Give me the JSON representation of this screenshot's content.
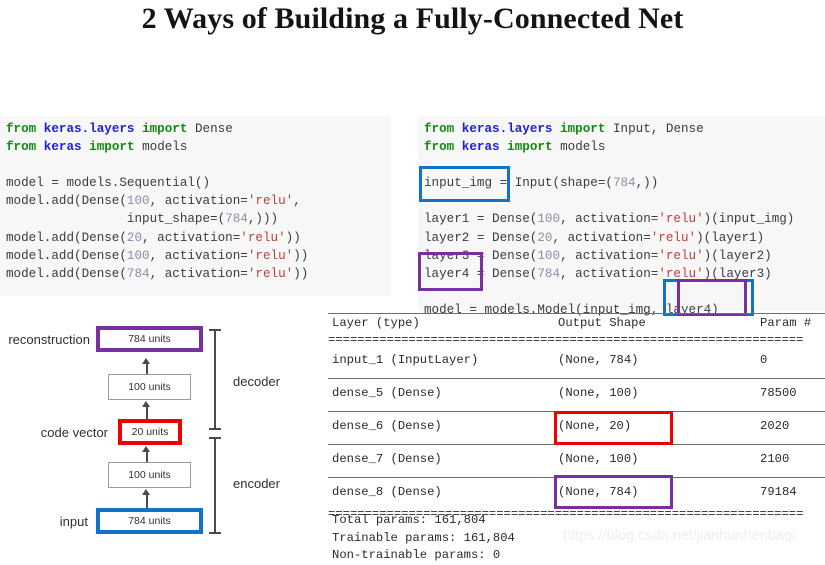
{
  "title": "2 Ways of Building a Fully-Connected Net",
  "colors": {
    "blue": "#1273c4",
    "purple": "#7a2f9e",
    "red": "#ee0000",
    "keyword_green": "#138a13",
    "module_blue": "#2020dd",
    "string_red": "#c43b3b",
    "number_gray": "#8d8da6",
    "code_background": "#f7f7f7"
  },
  "code_left": {
    "name": "sequential-api-code",
    "lines": [
      "from keras.layers import Dense",
      "from keras import models",
      "",
      "model = models.Sequential()",
      "model.add(Dense(100, activation='relu',",
      "                input_shape=(784,)))",
      "model.add(Dense(20, activation='relu'))",
      "model.add(Dense(100, activation='relu'))",
      "model.add(Dense(784, activation='relu'))"
    ]
  },
  "code_right": {
    "name": "functional-api-code",
    "lines": [
      "from keras.layers import Input, Dense",
      "from keras import models",
      "",
      "input_img = Input(shape=(784,))",
      "",
      "layer1 = Dense(100, activation='relu')(input_img)",
      "layer2 = Dense(20, activation='relu')(layer1)",
      "layer3 = Dense(100, activation='relu')(layer2)",
      "layer4 = Dense(784, activation='relu')(layer3)",
      "",
      "model = models.Model(input_img, layer4)"
    ],
    "highlights": [
      {
        "name": "input-img-definition",
        "color": "blue",
        "text": "input_img"
      },
      {
        "name": "layer4-definition",
        "color": "purple",
        "text": "layer4"
      },
      {
        "name": "model-input-arg",
        "color": "blue",
        "text": "input_img,"
      },
      {
        "name": "model-output-arg",
        "color": "purple",
        "text": "layer4)"
      }
    ]
  },
  "diagram": {
    "name": "autoencoder-architecture",
    "nodes": [
      {
        "label": "784 units",
        "side_label": "reconstruction",
        "border": "purple"
      },
      {
        "label": "100 units",
        "side_label": "",
        "border": "plain"
      },
      {
        "label": "20 units",
        "side_label": "code vector",
        "border": "red"
      },
      {
        "label": "100 units",
        "side_label": "",
        "border": "plain"
      },
      {
        "label": "784 units",
        "side_label": "input",
        "border": "blue"
      }
    ],
    "brackets": [
      {
        "label": "decoder"
      },
      {
        "label": "encoder"
      }
    ]
  },
  "summary": {
    "name": "model-summary-table",
    "headers": {
      "layer": "Layer (type)",
      "shape": "Output Shape",
      "param": "Param #"
    },
    "separator": "=================================================================",
    "rows": [
      {
        "layer": "input_1 (InputLayer)",
        "shape": "(None, 784)",
        "param": "0",
        "highlight": ""
      },
      {
        "layer": "dense_5 (Dense)",
        "shape": "(None, 100)",
        "param": "78500",
        "highlight": ""
      },
      {
        "layer": "dense_6 (Dense)",
        "shape": "(None, 20)",
        "param": "2020",
        "highlight": "red"
      },
      {
        "layer": "dense_7 (Dense)",
        "shape": "(None, 100)",
        "param": "2100",
        "highlight": ""
      },
      {
        "layer": "dense_8 (Dense)",
        "shape": "(None, 784)",
        "param": "79184",
        "highlight": "purple"
      }
    ],
    "totals": {
      "total": "Total params: 161,804",
      "trainable": "Trainable params: 161,804",
      "non_trainable": "Non-trainable params: 0"
    }
  },
  "watermark": "https://blog.csdn.net/jianhunhenbaqi"
}
